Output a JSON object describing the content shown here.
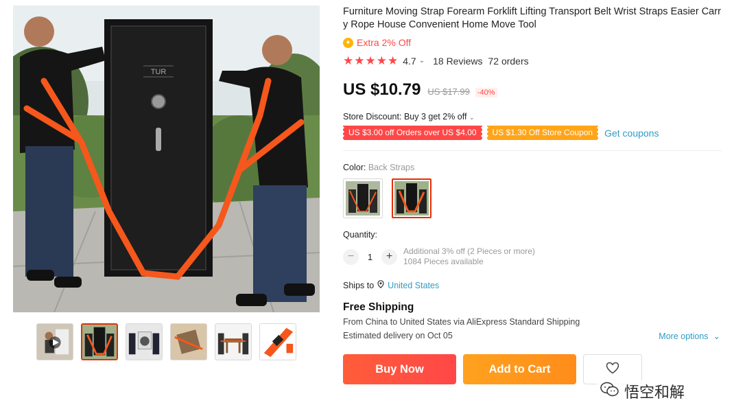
{
  "product": {
    "title": "Furniture Moving Strap Forearm Forklift Lifting Transport Belt Wrist Straps Easier Carry Rope House Convenient Home Move Tool",
    "extra_off": "Extra 2% Off",
    "rating": "4.7",
    "reviews": "18 Reviews",
    "orders": "72 orders",
    "stars": 5
  },
  "price": {
    "current": "US $10.79",
    "original": "US $17.99",
    "discount": "-40%"
  },
  "store_discount": {
    "label": "Store Discount:",
    "value": "Buy 3 get 2% off"
  },
  "coupons": {
    "coupon_1": "US $3.00 off Orders over US $4.00",
    "coupon_2": "US $1.30 Off Store Coupon",
    "get_link": "Get coupons"
  },
  "color": {
    "label": "Color:",
    "selected": "Back Straps"
  },
  "quantity": {
    "label": "Quantity:",
    "value": "1",
    "minus": "−",
    "plus": "+",
    "additional": "Additional 3% off (2 Pieces or more)",
    "available": "1084 Pieces available"
  },
  "shipping": {
    "ships_to_label": "Ships to",
    "country": "United States",
    "free": "Free Shipping",
    "from": "From China to United States via AliExpress Standard Shipping",
    "estimated": "Estimated delivery on Oct 05",
    "more_options": "More options"
  },
  "actions": {
    "buy_now": "Buy Now",
    "add_to_cart": "Add to Cart"
  },
  "watermark": {
    "text": "悟空和解"
  },
  "colors": {
    "accent_red": "#ff4747",
    "accent_orange": "#ffa519",
    "link_blue": "#2e9cc3",
    "strap_orange": "#f5571c"
  },
  "icons": [
    "coin-icon",
    "star-icon",
    "chevron-down-icon",
    "location-pin-icon",
    "heart-icon",
    "wechat-icon"
  ]
}
